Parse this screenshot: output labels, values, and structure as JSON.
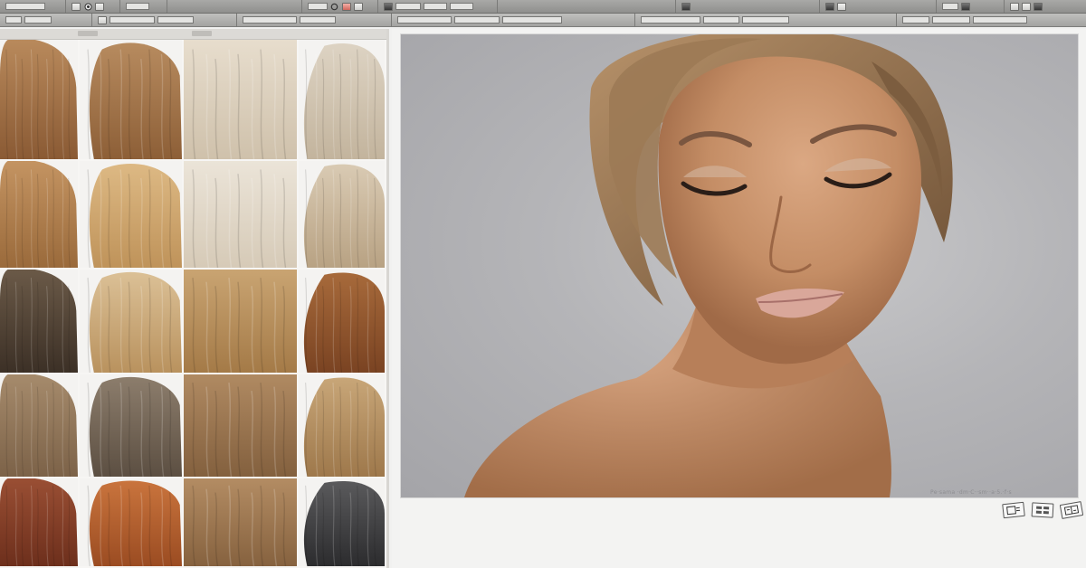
{
  "left_panel": {
    "header_tabs": [
      {
        "label": ""
      },
      {
        "label": ""
      }
    ]
  },
  "swatches": [
    {
      "name": "light-brown-straight",
      "top": "#b98a5c",
      "bottom": "#8a5a34"
    },
    {
      "name": "warm-brown-bob",
      "top": "#b78b5f",
      "bottom": "#8d5f37"
    },
    {
      "name": "platinum-blonde",
      "top": "#e7ddcd",
      "bottom": "#cfc1ab"
    },
    {
      "name": "ash-blonde",
      "top": "#ddd3c3",
      "bottom": "#c3b49d"
    },
    {
      "name": "honey-brown",
      "top": "#c49462",
      "bottom": "#9a6a3b"
    },
    {
      "name": "golden-blonde",
      "top": "#ddb984",
      "bottom": "#bf935a"
    },
    {
      "name": "pale-platinum",
      "top": "#ebe4d8",
      "bottom": "#d6cab7"
    },
    {
      "name": "beige-blonde",
      "top": "#d9cab3",
      "bottom": "#b8a283"
    },
    {
      "name": "dark-ash-brown",
      "top": "#6b5a48",
      "bottom": "#3c3026"
    },
    {
      "name": "sandy-blonde",
      "top": "#dbc096",
      "bottom": "#b9925e"
    },
    {
      "name": "caramel-blonde",
      "top": "#c9a472",
      "bottom": "#a47a47"
    },
    {
      "name": "auburn-brown",
      "top": "#a76a3b",
      "bottom": "#7a4322"
    },
    {
      "name": "mushroom-brown",
      "top": "#a68b6c",
      "bottom": "#7c6248"
    },
    {
      "name": "smoky-ash",
      "top": "#8c7d6c",
      "bottom": "#5c4f42"
    },
    {
      "name": "toffee-brown",
      "top": "#b08a62",
      "bottom": "#83603e"
    },
    {
      "name": "soft-golden",
      "top": "#c8a678",
      "bottom": "#9e784b"
    },
    {
      "name": "copper-red",
      "top": "#9a4f34",
      "bottom": "#6d2f1c"
    },
    {
      "name": "ginger-copper",
      "top": "#c9743d",
      "bottom": "#9b4c22"
    },
    {
      "name": "chestnut-blonde",
      "top": "#b38c63",
      "bottom": "#86623f"
    },
    {
      "name": "charcoal-silver",
      "top": "#5a5a5c",
      "bottom": "#2c2c2e"
    }
  ],
  "preview": {
    "caption": "Pe·sama ·dm·C··sm··a·5.·f·s",
    "portrait": {
      "background": "#b8b8bb",
      "skin": "#c9926a",
      "skin_shadow": "#a6704c",
      "hair": "#8a6a48",
      "lips": "#d9a79a"
    }
  },
  "bottom_icons": [
    {
      "name": "zoom-icon"
    },
    {
      "name": "grid-icon"
    },
    {
      "name": "compare-icon"
    }
  ]
}
